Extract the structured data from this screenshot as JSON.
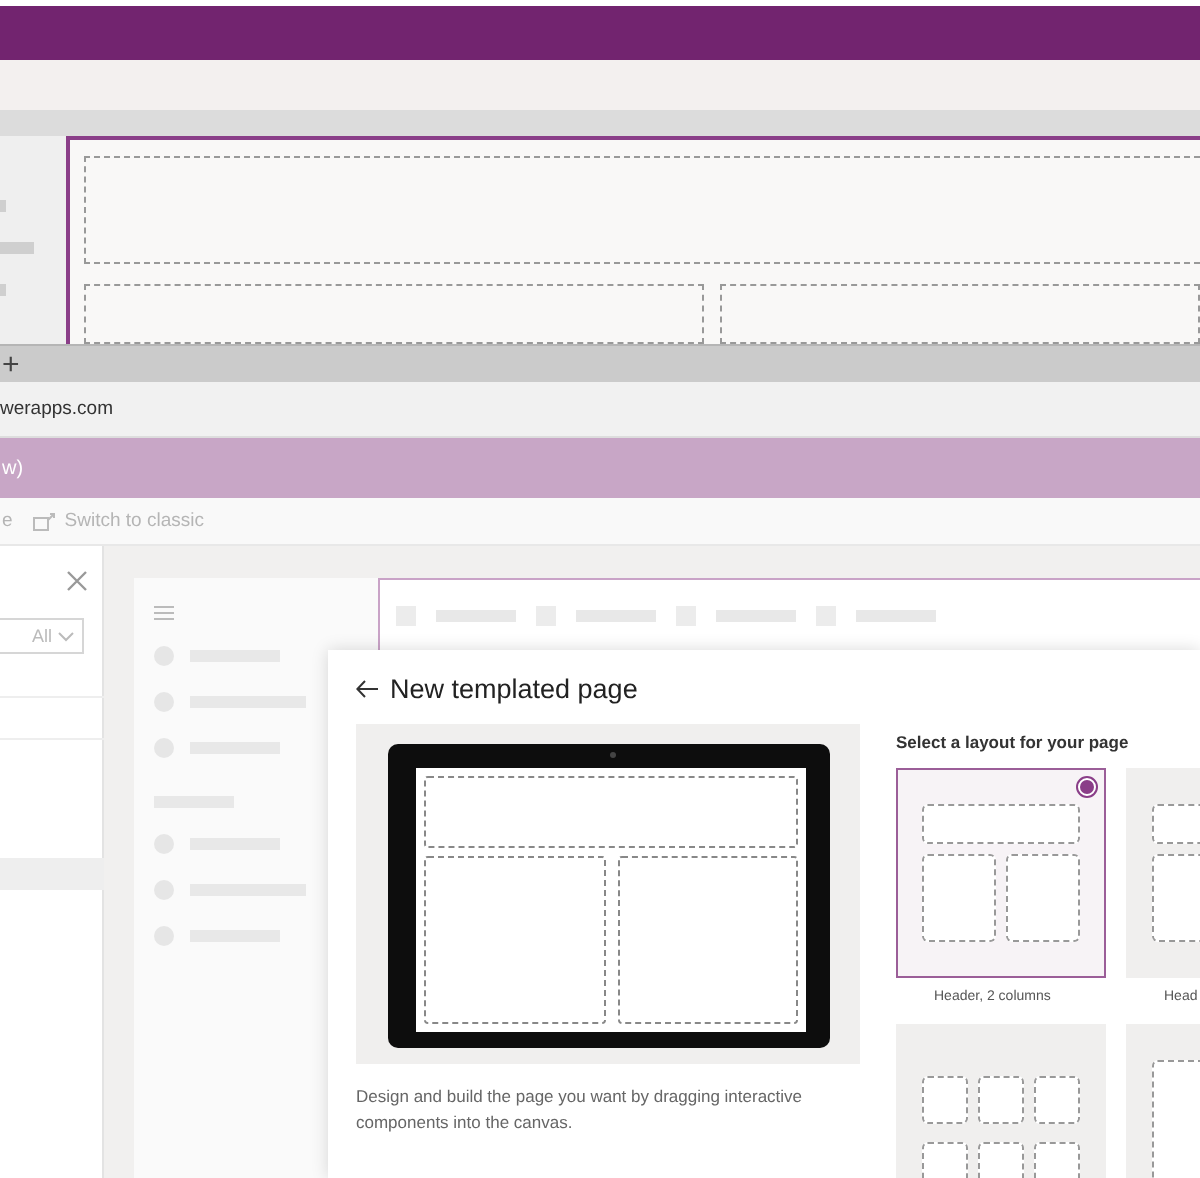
{
  "browser": {
    "new_tab_button": "+",
    "address": "werapps.com"
  },
  "app_bar": {
    "title": "w)"
  },
  "command_bar": {
    "cut_label": "e",
    "switch_label": "Switch to classic"
  },
  "side_panel": {
    "filter": {
      "value": "All"
    }
  },
  "dialog": {
    "title": "New templated page",
    "description": "Design and build the page you want by dragging interactive components into the canvas.",
    "layouts_heading": "Select a layout for your page",
    "layouts": [
      {
        "kind": "header-columns",
        "label": "Header, 2 columns",
        "selected": true
      },
      {
        "kind": "header-columns",
        "label": "Head",
        "selected": false
      },
      {
        "kind": "grid",
        "selected": false
      },
      {
        "kind": "single",
        "selected": false
      }
    ]
  }
}
